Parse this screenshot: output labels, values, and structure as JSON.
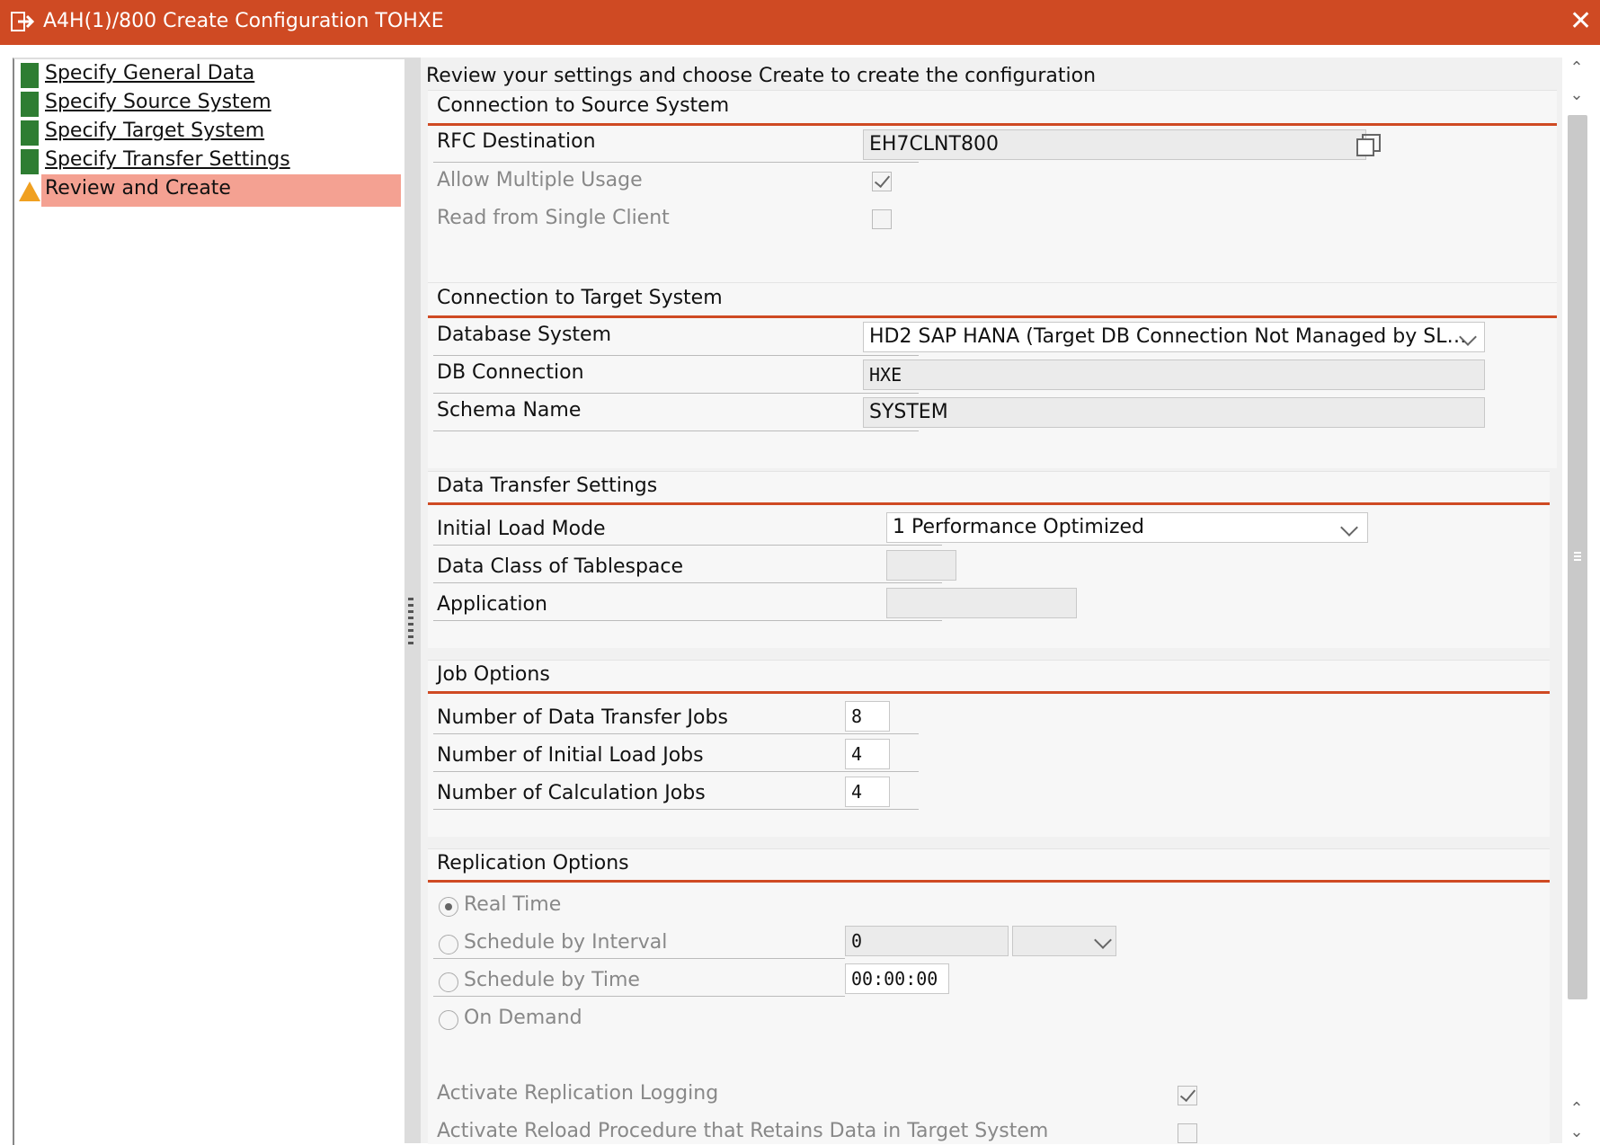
{
  "window": {
    "title": "A4H(1)/800 Create Configuration TOHXE",
    "title_icon": "exit-arrow-icon",
    "close_glyph": "✕"
  },
  "nav": {
    "items": [
      {
        "label": "Specify General Data",
        "status": "complete",
        "status_color": "#2e7d32"
      },
      {
        "label": "Specify Source System",
        "status": "complete",
        "status_color": "#2e7d32"
      },
      {
        "label": "Specify Target System",
        "status": "complete",
        "status_color": "#2e7d32"
      },
      {
        "label": "Specify Transfer Settings",
        "status": "complete",
        "status_color": "#2e7d32"
      },
      {
        "label": "Review and Create",
        "status": "current",
        "status_color": "#f0a020"
      }
    ]
  },
  "main": {
    "intro": "Review your settings and choose Create to create the configuration",
    "source": {
      "title": "Connection to Source System",
      "rfc_label": "RFC Destination",
      "rfc_value": "EH7CLNT800",
      "multiple_label": "Allow Multiple Usage",
      "multiple_checked": true,
      "single_label": "Read from Single Client",
      "single_checked": false
    },
    "target": {
      "title": "Connection to Target System",
      "db_label": "Database System",
      "db_value": "HD2 SAP HANA (Target DB Connection Not Managed by SL…",
      "conn_label": "DB Connection",
      "conn_value": "HXE",
      "schema_label": "Schema Name",
      "schema_value": "SYSTEM"
    },
    "transfer": {
      "title": "Data Transfer Settings",
      "load_label": "Initial Load Mode",
      "load_value": "1 Performance Optimized",
      "class_label": "Data Class of Tablespace",
      "class_value": "",
      "app_label": "Application",
      "app_value": ""
    },
    "jobs": {
      "title": "Job Options",
      "transfer_label": "Number of Data Transfer Jobs",
      "transfer_value": "8",
      "initial_label": "Number of Initial Load Jobs",
      "initial_value": "4",
      "calc_label": "Number of Calculation Jobs",
      "calc_value": "4"
    },
    "replication": {
      "title": "Replication Options",
      "realtime_label": "Real Time",
      "interval_label": "Schedule by Interval",
      "interval_value": "0",
      "interval_unit": "",
      "time_label": "Schedule by Time",
      "time_value": "00:00:00",
      "demand_label": "On Demand",
      "selected": "Real Time",
      "logging_label": "Activate Replication Logging",
      "logging_checked": true,
      "reload_label": "Activate Reload Procedure that Retains Data in Target System",
      "reload_checked": false
    }
  }
}
